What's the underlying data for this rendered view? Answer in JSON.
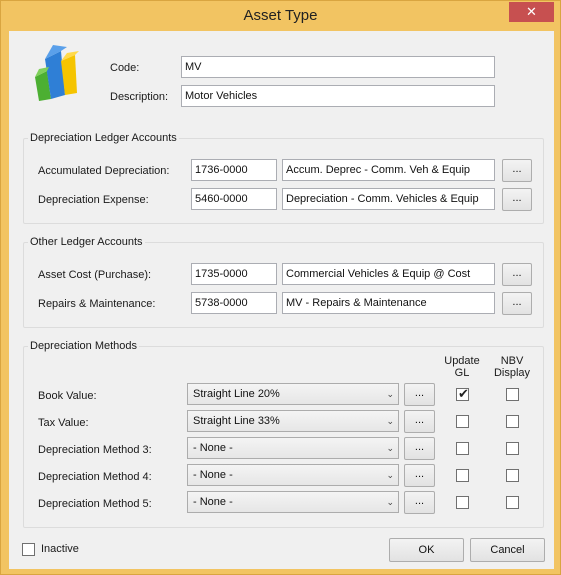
{
  "window": {
    "title": "Asset Type",
    "close_glyph": "✕"
  },
  "header": {
    "code_label": "Code:",
    "code_value": "MV",
    "description_label": "Description:",
    "description_value": "Motor Vehicles"
  },
  "depreciation_ledger": {
    "title": "Depreciation Ledger Accounts",
    "rows": [
      {
        "label": "Accumulated Depreciation:",
        "code": "1736-0000",
        "name": "Accum. Deprec - Comm. Veh & Equip",
        "btn": "..."
      },
      {
        "label": "Depreciation Expense:",
        "code": "5460-0000",
        "name": "Depreciation - Comm. Vehicles & Equip",
        "btn": "..."
      }
    ]
  },
  "other_ledger": {
    "title": "Other Ledger Accounts",
    "rows": [
      {
        "label": "Asset Cost (Purchase):",
        "code": "1735-0000",
        "name": "Commercial Vehicles & Equip @ Cost",
        "btn": "..."
      },
      {
        "label": "Repairs & Maintenance:",
        "code": "5738-0000",
        "name": "MV - Repairs & Maintenance",
        "btn": "..."
      }
    ]
  },
  "methods": {
    "title": "Depreciation Methods",
    "col_update_gl": "Update GL",
    "col_update_gl_1": "Update",
    "col_update_gl_2": "GL",
    "col_nbv_1": "NBV",
    "col_nbv_2": "Display",
    "rows": [
      {
        "label": "Book Value:",
        "method": "Straight Line 20%",
        "btn": "...",
        "update_gl": true,
        "nbv_display": false
      },
      {
        "label": "Tax Value:",
        "method": "Straight Line 33%",
        "btn": "...",
        "update_gl": false,
        "nbv_display": false
      },
      {
        "label": "Depreciation Method 3:",
        "method": "- None -",
        "btn": "...",
        "update_gl": false,
        "nbv_display": false
      },
      {
        "label": "Depreciation Method 4:",
        "method": "- None -",
        "btn": "...",
        "update_gl": false,
        "nbv_display": false
      },
      {
        "label": "Depreciation Method 5:",
        "method": "- None -",
        "btn": "...",
        "update_gl": false,
        "nbv_display": false
      }
    ]
  },
  "footer": {
    "inactive_label": "Inactive",
    "inactive_checked": false,
    "ok_label": "OK",
    "cancel_label": "Cancel"
  },
  "colors": {
    "titlebar": "#f2c462",
    "close": "#c75050"
  },
  "icons": {
    "app_icon": "bar-chart-logo-icon",
    "check": "✔",
    "dropdown": "chevron-down-icon"
  }
}
